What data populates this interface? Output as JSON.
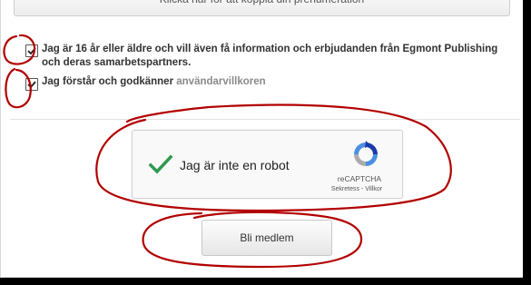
{
  "subscription": {
    "connect_label": "Klicka här för att koppla din prenumeration"
  },
  "consents": [
    {
      "checked": true,
      "label": "Jag är 16 år eller äldre och vill även få information och erbjudanden från Egmont Publishing och deras samarbetspartners."
    },
    {
      "checked": true,
      "label": "Jag förstår och godkänner ",
      "link_text": "användarvillkoren"
    }
  ],
  "captcha": {
    "label": "Jag är inte en robot",
    "checked": true,
    "brand": "reCAPTCHA",
    "links": "Sekretess - Villkor"
  },
  "join_button": {
    "label": "Bli medlem"
  },
  "colors": {
    "annotation": "#b20000",
    "check_green": "#2e9a4f"
  }
}
